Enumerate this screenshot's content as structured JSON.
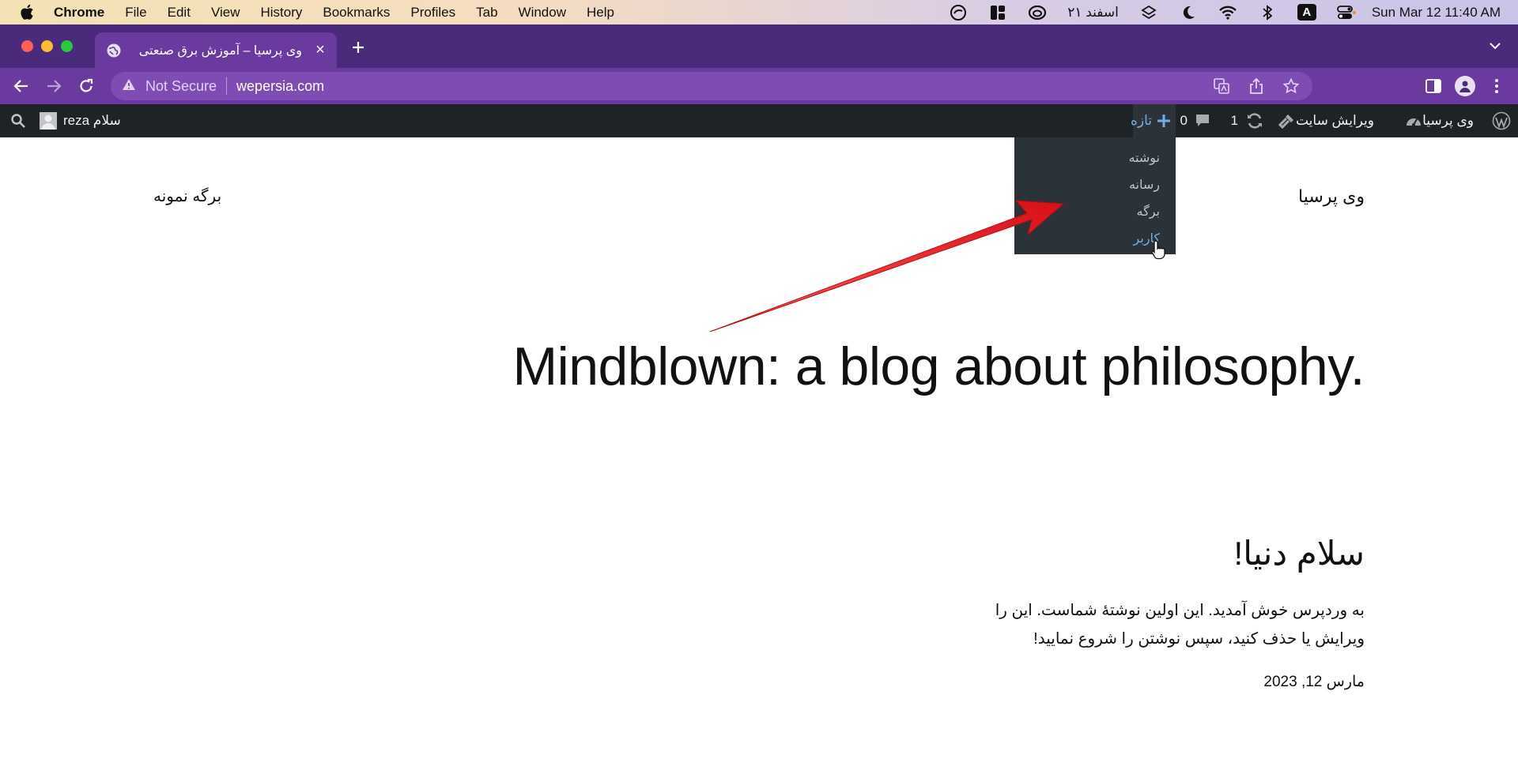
{
  "macos": {
    "app_name": "Chrome",
    "menus": [
      "File",
      "Edit",
      "View",
      "History",
      "Bookmarks",
      "Profiles",
      "Tab",
      "Window",
      "Help"
    ],
    "persian_date": "۲۱ اسفند",
    "keyboard_indicator": "A",
    "clock": "Sun Mar 12  11:40 AM"
  },
  "browser": {
    "tab_title": "وی پرسیا – آموزش برق صنعتی",
    "security_label": "Not Secure",
    "url": "wepersia.com"
  },
  "adminbar": {
    "site_name": "وی پرسیا",
    "edit_site": "ویرایش سایت",
    "updates_count": "1",
    "comments_count": "0",
    "new_label": "تازه",
    "greeting": "سلام reza"
  },
  "new_menu": {
    "items": [
      "نوشته",
      "رسانه",
      "برگه",
      "کاربر"
    ]
  },
  "site": {
    "title": "وی پرسیا",
    "nav_page": "برگه نمونه",
    "hero": "Mindblown: a blog about philosophy."
  },
  "post": {
    "title": "سلام دنیا!",
    "excerpt": "به وردپرس خوش آمدید. این اولین نوشتهٔ شماست. این را ویرایش یا حذف کنید، سپس نوشتن را شروع نمایید!",
    "date": "مارس 12, 2023"
  },
  "colors": {
    "admin_bar": "#1d2327",
    "submenu_bg": "#2c3338",
    "wp_blue": "#72aee6",
    "browser_purple": "#6a3a9e",
    "annotation_arrow": "#e8141c"
  }
}
